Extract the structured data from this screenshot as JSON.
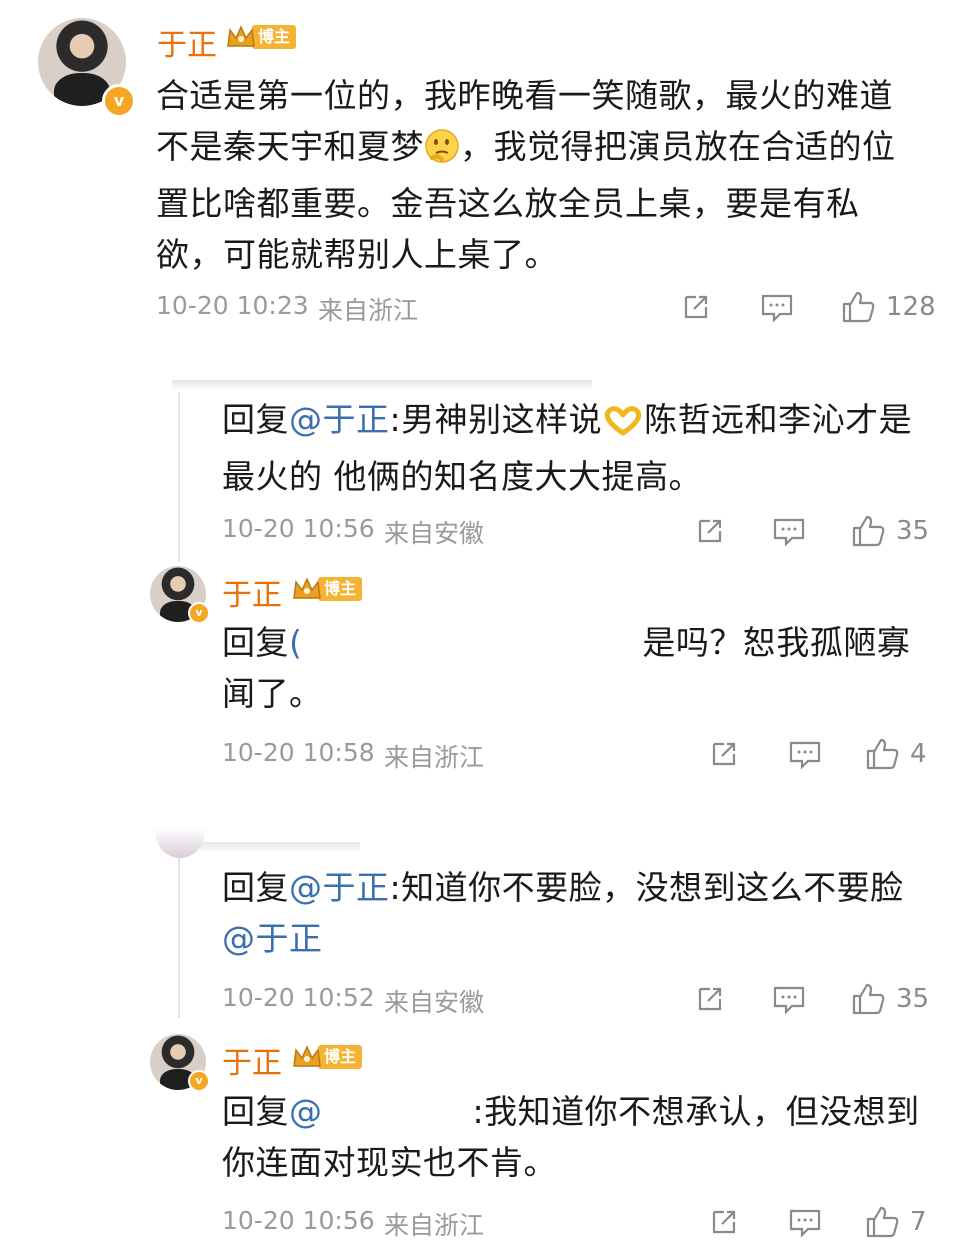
{
  "comments": [
    {
      "user": "于正",
      "badge": "博主",
      "text_parts": [
        "合适是第一位的，我昨晚看一笑随歌，最火的难道不是秦天宇和夏梦",
        "，我觉得把演员放在合适的位置比啥都重要。金吾这么放全员上桌，要是有私欲，可能就帮别人上桌了。"
      ],
      "time": "10-20 10:23",
      "source": "来自浙江",
      "likes": "128"
    },
    {
      "reply_prefix": "回复",
      "mention": "@于正",
      "text_a": ":男神别这样说",
      "text_b": "陈哲远和李沁才是最火的 他俩的知名度大大提高。",
      "time": "10-20 10:56",
      "source": "来自安徽",
      "likes": "35"
    },
    {
      "user": "于正",
      "badge": "博主",
      "reply_prefix": "回复",
      "text": "是吗？恕我孤陋寡闻了。",
      "time": "10-20 10:58",
      "source": "来自浙江",
      "likes": "4"
    },
    {
      "reply_prefix": "回复",
      "mention": "@于正",
      "text": ":知道你不要脸，没想到这么不要脸",
      "mention2": "@于正",
      "time": "10-20 10:52",
      "source": "来自安徽",
      "likes": "35"
    },
    {
      "user": "于正",
      "badge": "博主",
      "reply_prefix": "回复",
      "mention": "@",
      "text": ":我知道你不想承认，但没想到你连面对现实也不肯。",
      "time": "10-20 10:56",
      "source": "来自浙江",
      "likes": "7"
    }
  ],
  "colors": {
    "username": "#e8710a",
    "mention": "#3b6fb0",
    "meta": "#9a9a9a",
    "badge": "#f5b335"
  },
  "icons": [
    "share-icon",
    "comment-icon",
    "like-icon",
    "crown-icon",
    "verified-icon"
  ]
}
